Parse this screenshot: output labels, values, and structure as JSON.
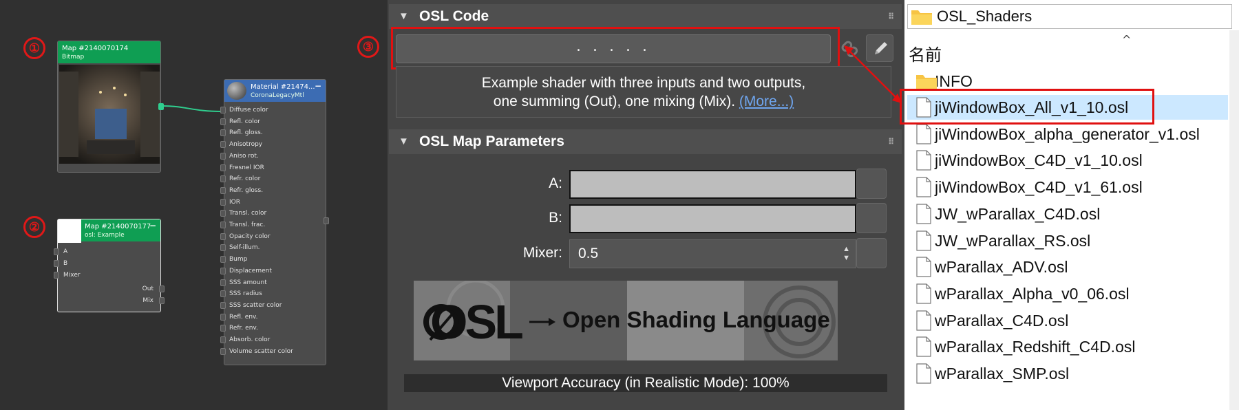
{
  "annotations": {
    "one": "①",
    "two": "②",
    "three": "③"
  },
  "node_editor": {
    "bitmap_node": {
      "title": "Map #2140070174",
      "subtitle": "Bitmap"
    },
    "material_node": {
      "title": "Material #21474...",
      "subtitle": "CoronaLegacyMtl",
      "minimize": "−",
      "ports": [
        "Diffuse color",
        "Refl. color",
        "Refl. gloss.",
        "Anisotropy",
        "Aniso rot.",
        "Fresnel IOR",
        "Refr. color",
        "Refr. gloss.",
        "IOR",
        "Transl. color",
        "Transl. frac.",
        "Opacity color",
        "Self-illum.",
        "Bump",
        "Displacement",
        "SSS amount",
        "SSS radius",
        "SSS scatter color",
        "Refl. env.",
        "Refr. env.",
        "Absorb. color",
        "Volume scatter color"
      ]
    },
    "osl_node": {
      "title": "Map #2140070177",
      "subtitle": "osl: Example",
      "minimize": "−",
      "inputs": [
        "A",
        "B",
        "Mixer"
      ],
      "outputs": [
        "Out",
        "Mix"
      ]
    }
  },
  "osl_panel": {
    "code_rollout": {
      "title": "OSL Code",
      "collapse": "▼",
      "grip": "⠿",
      "code_placeholder": ". . . . ."
    },
    "description": {
      "line1": "Example shader with three inputs and two outputs,",
      "line2": "one summing (Out), one mixing (Mix).",
      "more": "(More...)"
    },
    "params_rollout": {
      "title": "OSL Map Parameters",
      "collapse": "▼",
      "grip": "⠿",
      "a_label": "A:",
      "b_label": "B:",
      "mixer_label": "Mixer:",
      "mixer_value": "0.5"
    },
    "logo": {
      "osl": "OSL",
      "text": "Open Shading Language"
    },
    "viewport_accuracy": "Viewport Accuracy (in Realistic Mode): 100%"
  },
  "explorer": {
    "path": "OSL_Shaders",
    "column_header": "名前",
    "sort_caret": "^",
    "folder": "INFO",
    "files": [
      "jiWindowBox_All_v1_10.osl",
      "jiWindowBox_alpha_generator_v1.osl",
      "jiWindowBox_C4D_v1_10.osl",
      "jiWindowBox_C4D_v1_61.osl",
      "JW_wParallax_C4D.osl",
      "JW_wParallax_RS.osl",
      "wParallax_ADV.osl",
      "wParallax_Alpha_v0_06.osl",
      "wParallax_C4D.osl",
      "wParallax_Redshift_C4D.osl",
      "wParallax_SMP.osl"
    ],
    "selected_index": 0
  },
  "colors": {
    "node_header": "#0f9e53",
    "material_header": "#3c6cb3",
    "highlight": "#e01010",
    "selection": "#cce8ff",
    "link": "#6fa6f0"
  }
}
